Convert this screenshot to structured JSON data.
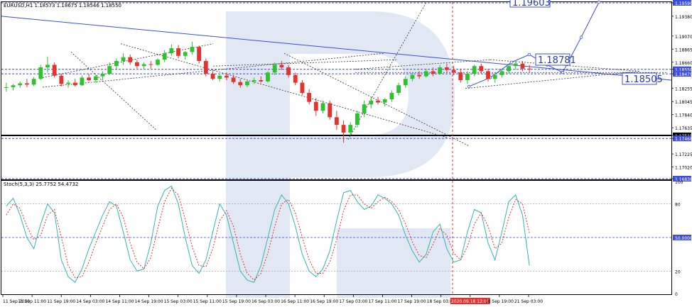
{
  "chart_data": {
    "type": "candlestick",
    "main": {
      "header": "EURUSD,H1  1.18573 1.18675 1.18546 1.18550",
      "ylim": [
        1.16838,
        1.1959
      ],
      "yticks": [
        "1.19590",
        "1.19380",
        "1.19070",
        "1.18865",
        "1.18660",
        "1.18550",
        "1.18479",
        "1.18255",
        "1.18045",
        "1.17840",
        "1.17635",
        "1.17515",
        "1.17468",
        "1.17225",
        "1.17020",
        "1.16838"
      ],
      "price_levels": {
        "top": 1.1959,
        "current": 1.1855,
        "ma": 1.18479,
        "support_upper": 1.17515,
        "support_lower": 1.17468,
        "bottom": 1.16838
      },
      "callouts": [
        "1.19603",
        "1.18781",
        "1.18505"
      ],
      "candles": [
        {
          "o": 1.1826,
          "h": 1.1834,
          "l": 1.182,
          "c": 1.1827
        },
        {
          "o": 1.1827,
          "h": 1.1832,
          "l": 1.1822,
          "c": 1.183
        },
        {
          "o": 1.183,
          "h": 1.1836,
          "l": 1.1826,
          "c": 1.1833
        },
        {
          "o": 1.1833,
          "h": 1.184,
          "l": 1.1827,
          "c": 1.1831
        },
        {
          "o": 1.1831,
          "h": 1.1843,
          "l": 1.1829,
          "c": 1.184
        },
        {
          "o": 1.184,
          "h": 1.1862,
          "l": 1.1838,
          "c": 1.1858
        },
        {
          "o": 1.1858,
          "h": 1.1875,
          "l": 1.185,
          "c": 1.1862
        },
        {
          "o": 1.1862,
          "h": 1.1866,
          "l": 1.1842,
          "c": 1.1845
        },
        {
          "o": 1.1845,
          "h": 1.1848,
          "l": 1.1828,
          "c": 1.1832
        },
        {
          "o": 1.1832,
          "h": 1.1838,
          "l": 1.1826,
          "c": 1.1834
        },
        {
          "o": 1.1834,
          "h": 1.184,
          "l": 1.1828,
          "c": 1.183
        },
        {
          "o": 1.183,
          "h": 1.1845,
          "l": 1.1829,
          "c": 1.1842
        },
        {
          "o": 1.1842,
          "h": 1.1848,
          "l": 1.1836,
          "c": 1.1838
        },
        {
          "o": 1.1838,
          "h": 1.1846,
          "l": 1.1834,
          "c": 1.1844
        },
        {
          "o": 1.1844,
          "h": 1.1852,
          "l": 1.1838,
          "c": 1.1848
        },
        {
          "o": 1.1848,
          "h": 1.1866,
          "l": 1.1846,
          "c": 1.186
        },
        {
          "o": 1.186,
          "h": 1.1872,
          "l": 1.1854,
          "c": 1.1868
        },
        {
          "o": 1.1868,
          "h": 1.188,
          "l": 1.1862,
          "c": 1.1874
        },
        {
          "o": 1.1874,
          "h": 1.1878,
          "l": 1.1862,
          "c": 1.1866
        },
        {
          "o": 1.1866,
          "h": 1.187,
          "l": 1.1856,
          "c": 1.186
        },
        {
          "o": 1.186,
          "h": 1.1866,
          "l": 1.1855,
          "c": 1.1863
        },
        {
          "o": 1.1863,
          "h": 1.1868,
          "l": 1.1856,
          "c": 1.1862
        },
        {
          "o": 1.1862,
          "h": 1.1872,
          "l": 1.186,
          "c": 1.187
        },
        {
          "o": 1.187,
          "h": 1.1885,
          "l": 1.1866,
          "c": 1.188
        },
        {
          "o": 1.188,
          "h": 1.1894,
          "l": 1.1876,
          "c": 1.1888
        },
        {
          "o": 1.1888,
          "h": 1.1893,
          "l": 1.1872,
          "c": 1.1876
        },
        {
          "o": 1.1876,
          "h": 1.1884,
          "l": 1.187,
          "c": 1.1882
        },
        {
          "o": 1.1882,
          "h": 1.1898,
          "l": 1.1878,
          "c": 1.189
        },
        {
          "o": 1.189,
          "h": 1.1892,
          "l": 1.1864,
          "c": 1.1868
        },
        {
          "o": 1.1868,
          "h": 1.1872,
          "l": 1.1844,
          "c": 1.1848
        },
        {
          "o": 1.1848,
          "h": 1.1852,
          "l": 1.1838,
          "c": 1.184
        },
        {
          "o": 1.184,
          "h": 1.1848,
          "l": 1.1836,
          "c": 1.1845
        },
        {
          "o": 1.1845,
          "h": 1.185,
          "l": 1.1838,
          "c": 1.1842
        },
        {
          "o": 1.1842,
          "h": 1.1846,
          "l": 1.1832,
          "c": 1.1835
        },
        {
          "o": 1.1835,
          "h": 1.184,
          "l": 1.1826,
          "c": 1.183
        },
        {
          "o": 1.183,
          "h": 1.1838,
          "l": 1.1827,
          "c": 1.1836
        },
        {
          "o": 1.1836,
          "h": 1.1842,
          "l": 1.1832,
          "c": 1.1838
        },
        {
          "o": 1.1838,
          "h": 1.1844,
          "l": 1.1834,
          "c": 1.1836
        },
        {
          "o": 1.1836,
          "h": 1.1852,
          "l": 1.1834,
          "c": 1.185
        },
        {
          "o": 1.185,
          "h": 1.1866,
          "l": 1.1846,
          "c": 1.1862
        },
        {
          "o": 1.1862,
          "h": 1.1868,
          "l": 1.1854,
          "c": 1.1858
        },
        {
          "o": 1.1858,
          "h": 1.1862,
          "l": 1.1842,
          "c": 1.1846
        },
        {
          "o": 1.1846,
          "h": 1.185,
          "l": 1.183,
          "c": 1.1834
        },
        {
          "o": 1.1834,
          "h": 1.1838,
          "l": 1.1815,
          "c": 1.1818
        },
        {
          "o": 1.1818,
          "h": 1.1824,
          "l": 1.18,
          "c": 1.1804
        },
        {
          "o": 1.1804,
          "h": 1.181,
          "l": 1.1782,
          "c": 1.179
        },
        {
          "o": 1.179,
          "h": 1.1806,
          "l": 1.1786,
          "c": 1.1802
        },
        {
          "o": 1.1802,
          "h": 1.1806,
          "l": 1.1776,
          "c": 1.178
        },
        {
          "o": 1.178,
          "h": 1.179,
          "l": 1.176,
          "c": 1.1768
        },
        {
          "o": 1.1768,
          "h": 1.1775,
          "l": 1.174,
          "c": 1.1756
        },
        {
          "o": 1.1756,
          "h": 1.1772,
          "l": 1.1752,
          "c": 1.1768
        },
        {
          "o": 1.1768,
          "h": 1.179,
          "l": 1.1764,
          "c": 1.1786
        },
        {
          "o": 1.1786,
          "h": 1.1806,
          "l": 1.178,
          "c": 1.18
        },
        {
          "o": 1.18,
          "h": 1.1812,
          "l": 1.1794,
          "c": 1.1806
        },
        {
          "o": 1.1806,
          "h": 1.1812,
          "l": 1.18,
          "c": 1.1803
        },
        {
          "o": 1.1803,
          "h": 1.181,
          "l": 1.1797,
          "c": 1.1808
        },
        {
          "o": 1.1808,
          "h": 1.1822,
          "l": 1.1804,
          "c": 1.1818
        },
        {
          "o": 1.1818,
          "h": 1.1834,
          "l": 1.1814,
          "c": 1.183
        },
        {
          "o": 1.183,
          "h": 1.1844,
          "l": 1.1826,
          "c": 1.184
        },
        {
          "o": 1.184,
          "h": 1.185,
          "l": 1.1836,
          "c": 1.1846
        },
        {
          "o": 1.1846,
          "h": 1.1852,
          "l": 1.184,
          "c": 1.1844
        },
        {
          "o": 1.1844,
          "h": 1.1856,
          "l": 1.1842,
          "c": 1.1852
        },
        {
          "o": 1.1852,
          "h": 1.1858,
          "l": 1.1844,
          "c": 1.1848
        },
        {
          "o": 1.1848,
          "h": 1.1862,
          "l": 1.1846,
          "c": 1.1858
        },
        {
          "o": 1.1858,
          "h": 1.1864,
          "l": 1.185,
          "c": 1.1854
        },
        {
          "o": 1.1854,
          "h": 1.186,
          "l": 1.1846,
          "c": 1.185
        },
        {
          "o": 1.185,
          "h": 1.1856,
          "l": 1.1834,
          "c": 1.1838
        },
        {
          "o": 1.1838,
          "h": 1.1852,
          "l": 1.1832,
          "c": 1.1848
        },
        {
          "o": 1.1848,
          "h": 1.1862,
          "l": 1.1844,
          "c": 1.186
        },
        {
          "o": 1.186,
          "h": 1.1864,
          "l": 1.1848,
          "c": 1.1852
        },
        {
          "o": 1.1852,
          "h": 1.1856,
          "l": 1.1836,
          "c": 1.184
        },
        {
          "o": 1.184,
          "h": 1.185,
          "l": 1.1834,
          "c": 1.1846
        },
        {
          "o": 1.1846,
          "h": 1.1856,
          "l": 1.1842,
          "c": 1.1852
        },
        {
          "o": 1.1852,
          "h": 1.1864,
          "l": 1.1848,
          "c": 1.186
        },
        {
          "o": 1.186,
          "h": 1.1868,
          "l": 1.1854,
          "c": 1.1864
        },
        {
          "o": 1.1864,
          "h": 1.1868,
          "l": 1.1852,
          "c": 1.1856
        },
        {
          "o": 1.1856,
          "h": 1.1862,
          "l": 1.185,
          "c": 1.1855
        }
      ]
    },
    "oscillator": {
      "header": "Stoch(5,3,3) 25.7752 54.4732",
      "ylim": [
        0,
        100
      ],
      "yticks": [
        "100",
        "80",
        "50.0000",
        "20",
        "0"
      ],
      "main_line": [
        78,
        85,
        70,
        50,
        40,
        62,
        80,
        72,
        30,
        15,
        10,
        22,
        40,
        55,
        70,
        82,
        78,
        55,
        30,
        20,
        22,
        45,
        78,
        92,
        96,
        80,
        50,
        25,
        18,
        30,
        55,
        80,
        70,
        45,
        20,
        12,
        10,
        25,
        50,
        75,
        88,
        80,
        60,
        35,
        20,
        15,
        22,
        38,
        65,
        90,
        92,
        82,
        75,
        78,
        88,
        85,
        80,
        70,
        52,
        38,
        28,
        35,
        55,
        62,
        40,
        28,
        30,
        55,
        75,
        72,
        45,
        30,
        55,
        82,
        88,
        70,
        25
      ],
      "signal_line": [
        70,
        80,
        76,
        60,
        48,
        52,
        70,
        75,
        50,
        25,
        14,
        15,
        28,
        45,
        60,
        75,
        80,
        68,
        45,
        28,
        22,
        32,
        58,
        82,
        94,
        88,
        66,
        42,
        25,
        24,
        40,
        65,
        74,
        60,
        35,
        18,
        12,
        18,
        36,
        60,
        80,
        84,
        72,
        50,
        30,
        18,
        18,
        28,
        48,
        74,
        88,
        88,
        80,
        76,
        82,
        86,
        82,
        75,
        62,
        46,
        34,
        32,
        44,
        58,
        52,
        36,
        30,
        42,
        62,
        72,
        60,
        40,
        45,
        68,
        84,
        80,
        54
      ],
      "signal_color": "#e4322f",
      "main_color": "#35b5b0"
    },
    "x_ticks": [
      "11 Sep 2020",
      "11 Sep 11:00",
      "11 Sep 19:00",
      "14 Sep 03:00",
      "14 Sep 11:00",
      "14 Sep 19:00",
      "15 Sep 03:00",
      "15 Sep 11:00",
      "15 Sep 19:00",
      "16 Sep 03:00",
      "16 Sep 11:00",
      "16 Sep 19:00",
      "17 Sep 03:00",
      "17 Sep 11:00",
      "17 Sep 19:00",
      "18 Sep 03:00",
      "2020.09.18 12:00",
      "18 Sep 19:00",
      "21 Sep 03:00"
    ],
    "colors": {
      "bull": "#2fc12f",
      "bear": "#e4322f",
      "trend": "#3d4fd8",
      "forecast": "#3d4fd8",
      "highlight": "#e4322f",
      "watermark": "#c9d6ea"
    }
  }
}
